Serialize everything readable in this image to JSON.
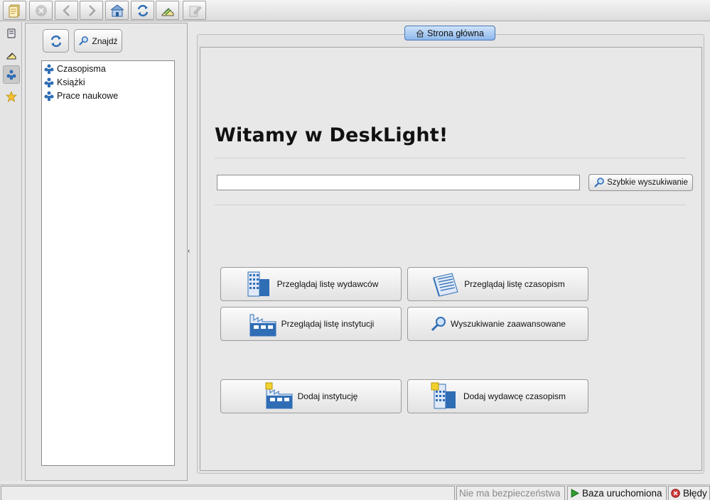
{
  "toolbar": {
    "buttons": [
      {
        "icon": "document-add-icon"
      },
      {
        "icon": "stop-icon"
      },
      {
        "icon": "arrow-left-icon"
      },
      {
        "icon": "arrow-right-icon"
      },
      {
        "icon": "home-icon"
      },
      {
        "icon": "refresh-icon"
      },
      {
        "icon": "scanner-icon"
      },
      {
        "icon": "edit-note-icon"
      }
    ]
  },
  "side_strip": {
    "items": [
      {
        "icon": "book-icon",
        "active": false
      },
      {
        "icon": "scanner-icon",
        "active": false
      },
      {
        "icon": "tree-icon",
        "active": true
      },
      {
        "icon": "star-icon",
        "active": false
      }
    ]
  },
  "left_panel": {
    "refresh_button": {
      "icon": "refresh-icon"
    },
    "find_button": {
      "label": "Znajdź",
      "icon": "search-icon"
    },
    "tree": [
      {
        "label": "Czasopisma",
        "icon": "tree-node-icon"
      },
      {
        "label": "Książki",
        "icon": "tree-node-icon"
      },
      {
        "label": "Prace naukowe",
        "icon": "tree-node-icon"
      }
    ]
  },
  "main": {
    "tab": {
      "label": "Strona główna",
      "icon": "home-icon"
    },
    "welcome": "Witamy w DeskLight!",
    "quick_search": {
      "value": "",
      "button_label": "Szybkie wyszukiwanie"
    },
    "actions": [
      {
        "label": "Przeglądaj listę wydawców",
        "icon": "publisher-building-icon"
      },
      {
        "label": "Przeglądaj listę czasopism",
        "icon": "journal-stack-icon"
      },
      {
        "label": "Przeglądaj listę instytucji",
        "icon": "factory-icon"
      },
      {
        "label": "Wyszukiwanie zaawansowane",
        "icon": "magnifier-icon"
      },
      {
        "label": "Dodaj instytucję",
        "icon": "factory-add-icon"
      },
      {
        "label": "Dodaj wydawcę czasopism",
        "icon": "publisher-add-icon"
      }
    ]
  },
  "status_bar": {
    "message": "",
    "security": "Nie ma bezpieczeństwa",
    "database": "Baza uruchomiona",
    "errors": "Błędy"
  },
  "colors": {
    "tab_gradient_top": "#cfe3fb",
    "tab_gradient_bottom": "#8db8ec",
    "tab_border": "#4a77b4",
    "icon_blue": "#2f6db5",
    "status_green": "#2e9e2e",
    "error_red": "#d23b3b"
  }
}
